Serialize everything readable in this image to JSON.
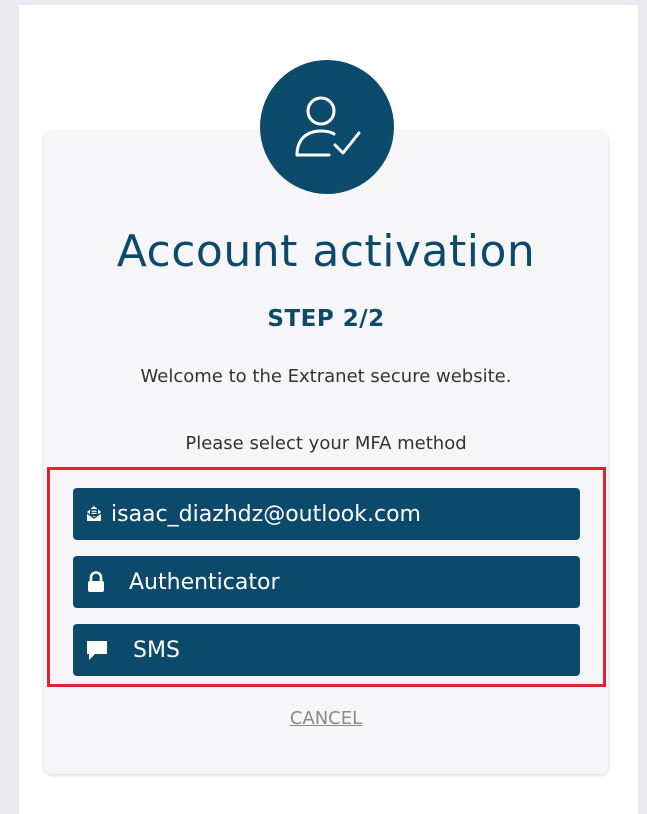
{
  "title": "Account activation",
  "step": "STEP 2/2",
  "welcome": "Welcome to the Extranet secure website.",
  "mfa_prompt": "Please select your MFA method",
  "methods": [
    {
      "label": "isaac_diazhdz@outlook.com",
      "icon": "email-envelope-icon"
    },
    {
      "label": "Authenticator",
      "icon": "lock-icon"
    },
    {
      "label": "SMS",
      "icon": "chat-bubble-icon"
    }
  ],
  "cancel": "CANCEL",
  "colors": {
    "primary": "#0c4a6c",
    "highlight": "#e3222f",
    "card_bg": "#f6f5f7",
    "page_bg": "#ebebef"
  },
  "avatar_icon": "user-check-icon"
}
